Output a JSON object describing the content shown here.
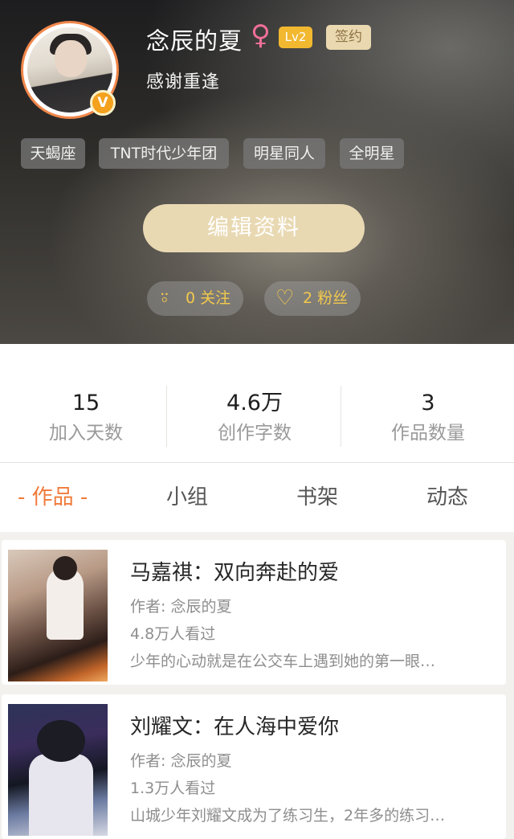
{
  "profile": {
    "username": "念辰的夏",
    "gender_icon": "♀",
    "level": "Lv2",
    "signed_badge": "签约",
    "verified_badge": "V",
    "motto": "感谢重逢",
    "tags": [
      "天蝎座",
      "TNT时代少年团",
      "明星同人",
      "全明星"
    ],
    "edit_button": "编辑资料",
    "follow": {
      "icon": "add-user-icon",
      "label": "0 关注"
    },
    "fans": {
      "icon": "heart-icon",
      "label": "2 粉丝"
    }
  },
  "stats": [
    {
      "value": "15",
      "label": "加入天数"
    },
    {
      "value": "4.6万",
      "label": "创作字数"
    },
    {
      "value": "3",
      "label": "作品数量"
    }
  ],
  "tabs": [
    {
      "label": "- 作品 -",
      "active": true
    },
    {
      "label": "小组",
      "active": false
    },
    {
      "label": "书架",
      "active": false
    },
    {
      "label": "动态",
      "active": false
    }
  ],
  "works": [
    {
      "title": "马嘉祺：双向奔赴的爱",
      "author": "作者: 念辰的夏",
      "views": "4.8万人看过",
      "description": "少年的心动就是在公交车上遇到她的第一眼…"
    },
    {
      "title": "刘耀文：在人海中爱你",
      "author": "作者: 念辰的夏",
      "views": "1.3万人看过",
      "description": "山城少年刘耀文成为了练习生，2年多的练习…"
    }
  ],
  "colors": {
    "accent": "#f07a3a",
    "level_badge": "#f2b830",
    "edit_button": "#e9d9b3",
    "follow_text": "#f2c94c"
  }
}
